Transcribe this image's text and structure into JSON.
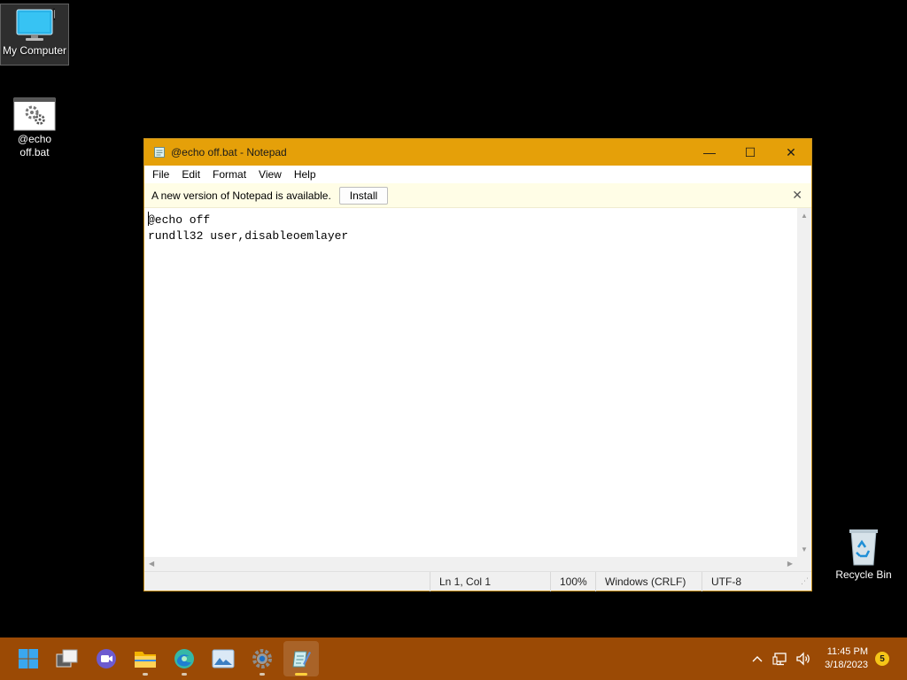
{
  "desktop": {
    "icons": [
      {
        "label": "My Computer"
      },
      {
        "label": "@echo\noff.bat"
      },
      {
        "label": "Recycle Bin"
      }
    ]
  },
  "window": {
    "title": "@echo off.bat - Notepad",
    "controls": {
      "minimize": "—",
      "maximize": "☐",
      "close": "✕"
    },
    "menu": [
      "File",
      "Edit",
      "Format",
      "View",
      "Help"
    ],
    "notice": {
      "text": "A new version of Notepad is available.",
      "install_label": "Install",
      "close": "✕"
    },
    "content": "@echo off\nrundll32 user,disableoemlayer",
    "status": {
      "position": "Ln 1, Col 1",
      "zoom": "100%",
      "line_ending": "Windows (CRLF)",
      "encoding": "UTF-8"
    }
  },
  "taskbar": {
    "apps": [
      {
        "icon": "start-windows-icon"
      },
      {
        "icon": "task-view-icon"
      },
      {
        "icon": "meet-chat-icon"
      },
      {
        "icon": "file-explorer-icon"
      },
      {
        "icon": "edge-browser-icon"
      },
      {
        "icon": "photos-icon"
      },
      {
        "icon": "settings-gear-icon"
      },
      {
        "icon": "notepad-icon"
      }
    ],
    "clock": {
      "time": "11:45 PM",
      "date": "3/18/2023"
    },
    "notification_count": "5"
  },
  "colors": {
    "accent": "#e5a009",
    "taskbar": "#9b4a05",
    "notice_bg": "#fffde6"
  }
}
